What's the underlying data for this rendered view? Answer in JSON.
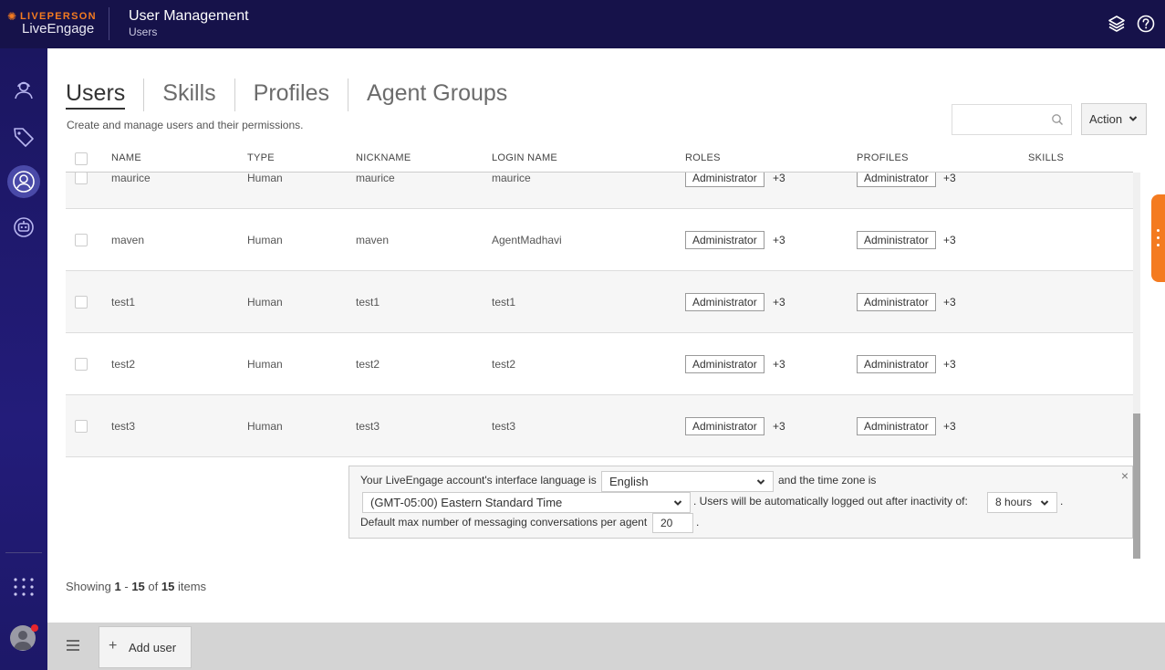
{
  "brand": {
    "top": "LIVEPERSON",
    "name": "LiveEngage"
  },
  "header": {
    "title": "User Management",
    "subtitle": "Users"
  },
  "tabs": [
    {
      "label": "Users",
      "active": true
    },
    {
      "label": "Skills",
      "active": false
    },
    {
      "label": "Profiles",
      "active": false
    },
    {
      "label": "Agent Groups",
      "active": false
    }
  ],
  "page": {
    "description": "Create and manage users and their permissions."
  },
  "search": {
    "placeholder": "",
    "value": ""
  },
  "action": {
    "label": "Action"
  },
  "table": {
    "columns": [
      "NAME",
      "TYPE",
      "NICKNAME",
      "LOGIN NAME",
      "ROLES",
      "PROFILES",
      "SKILLS"
    ],
    "rows": [
      {
        "name": "maurice",
        "type": "Human",
        "nickname": "maurice",
        "login": "maurice",
        "role": "Administrator",
        "role_more": "+3",
        "profile": "Administrator",
        "profile_more": "+3",
        "skills": ""
      },
      {
        "name": "maven",
        "type": "Human",
        "nickname": "maven",
        "login": "AgentMadhavi",
        "role": "Administrator",
        "role_more": "+3",
        "profile": "Administrator",
        "profile_more": "+3",
        "skills": ""
      },
      {
        "name": "test1",
        "type": "Human",
        "nickname": "test1",
        "login": "test1",
        "role": "Administrator",
        "role_more": "+3",
        "profile": "Administrator",
        "profile_more": "+3",
        "skills": ""
      },
      {
        "name": "test2",
        "type": "Human",
        "nickname": "test2",
        "login": "test2",
        "role": "Administrator",
        "role_more": "+3",
        "profile": "Administrator",
        "profile_more": "+3",
        "skills": ""
      },
      {
        "name": "test3",
        "type": "Human",
        "nickname": "test3",
        "login": "test3",
        "role": "Administrator",
        "role_more": "+3",
        "profile": "Administrator",
        "profile_more": "+3",
        "skills": ""
      }
    ]
  },
  "notice": {
    "text1": "Your LiveEngage account's interface language is",
    "language": "English",
    "text2": "and the time zone is",
    "timezone": "(GMT-05:00) Eastern Standard Time",
    "text3": ". Users will be automatically logged out after inactivity of:",
    "inactivity": "8 hours",
    "period": ".",
    "text4": "Default max number of messaging conversations per agent",
    "max_conversations": "20",
    "period2": ".",
    "close": "×"
  },
  "pagination": {
    "prefix": "Showing",
    "from": "1",
    "dash": "-",
    "to": "15",
    "of": "of",
    "total": "15",
    "suffix": "items"
  },
  "footer": {
    "menu_icon": "☰",
    "add_plus": "+",
    "add_user": "Add user"
  },
  "colors": {
    "topbar": "#16124a",
    "accent": "#f47b20",
    "notification": "#e8262c"
  },
  "icons": [
    "layers-icon",
    "help-icon",
    "agent-icon",
    "tag-icon",
    "users-icon",
    "bot-icon",
    "apps-grid-icon",
    "avatar",
    "search-icon",
    "chevron-down-icon",
    "close-icon",
    "menu-icon",
    "plus-icon"
  ]
}
